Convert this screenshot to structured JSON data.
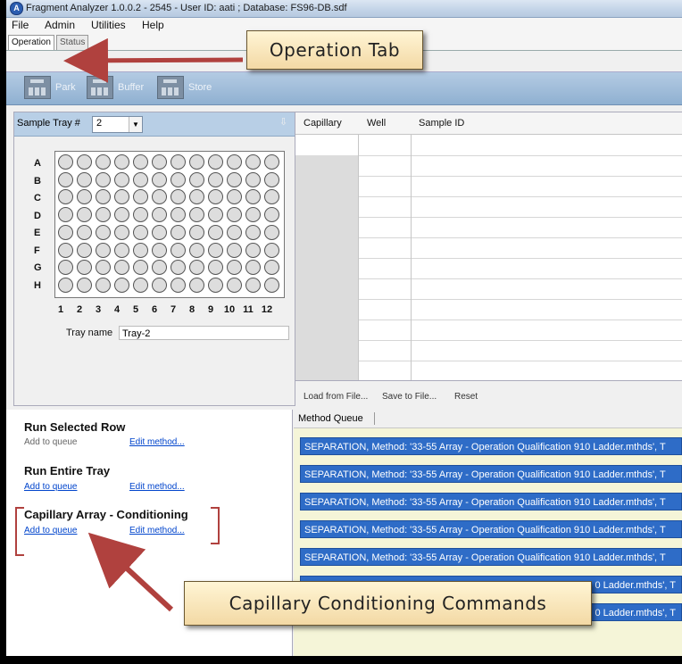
{
  "window": {
    "title": "Fragment Analyzer 1.0.0.2 - 2545 - User ID: aati ; Database: FS96-DB.sdf"
  },
  "menu": [
    "File",
    "Admin",
    "Utilities",
    "Help"
  ],
  "tabs": {
    "operation": "Operation",
    "status": "Status"
  },
  "toolbar": {
    "park": "Park",
    "buffer": "Buffer",
    "store": "Store"
  },
  "tray": {
    "label": "Sample Tray #",
    "selected": "2",
    "rows": [
      "A",
      "B",
      "C",
      "D",
      "E",
      "F",
      "G",
      "H"
    ],
    "columns": [
      "1",
      "2",
      "3",
      "4",
      "5",
      "6",
      "7",
      "8",
      "9",
      "10",
      "11",
      "12"
    ],
    "name_label": "Tray name",
    "name_value": "Tray-2"
  },
  "grid": {
    "headers": [
      "Capillary",
      "Well",
      "Sample ID"
    ],
    "links": {
      "load": "Load from File...",
      "save": "Save to File...",
      "reset": "Reset"
    }
  },
  "commands": {
    "run_selected": {
      "title": "Run Selected Row",
      "add": "Add to queue",
      "edit": "Edit method..."
    },
    "run_entire": {
      "title": "Run Entire Tray",
      "add": "Add to queue",
      "edit": "Edit method..."
    },
    "conditioning": {
      "title": "Capillary Array - Conditioning",
      "add": "Add to queue",
      "edit": "Edit method..."
    }
  },
  "method_queue": {
    "title": "Method Queue",
    "items": [
      "SEPARATION, Method: '33-55 Array - Operation Qualification 910 Ladder.mthds', T",
      "SEPARATION, Method: '33-55 Array - Operation Qualification 910 Ladder.mthds', T",
      "SEPARATION, Method: '33-55 Array - Operation Qualification 910 Ladder.mthds', T",
      "SEPARATION, Method: '33-55 Array - Operation Qualification 910 Ladder.mthds', T",
      "SEPARATION, Method: '33-55 Array - Operation Qualification 910 Ladder.mthds', T"
    ],
    "partial_items": [
      "0 Ladder.mthds', T",
      "0 Ladder.mthds', T"
    ]
  },
  "annotations": {
    "operation_tab": "Operation Tab",
    "capillary_conditioning": "Capillary Conditioning Commands",
    "arrow_color": "#b0413e"
  }
}
